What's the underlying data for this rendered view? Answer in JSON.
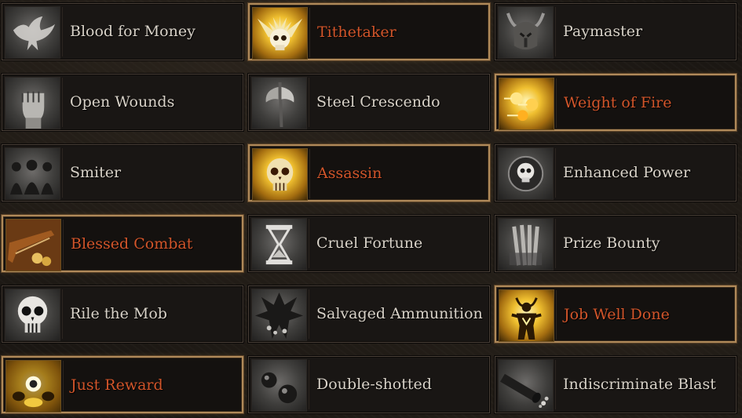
{
  "perks": [
    {
      "label": "Blood for Money",
      "icon": "dove-icon",
      "selected": false
    },
    {
      "label": "Tithetaker",
      "icon": "winged-skull-icon",
      "selected": true
    },
    {
      "label": "Paymaster",
      "icon": "horned-helmet-icon",
      "selected": false
    },
    {
      "label": "Open Wounds",
      "icon": "fist-icon",
      "selected": false
    },
    {
      "label": "Steel Crescendo",
      "icon": "axe-icon",
      "selected": false
    },
    {
      "label": "Weight of Fire",
      "icon": "fire-orbs-icon",
      "selected": true
    },
    {
      "label": "Smiter",
      "icon": "shadow-figures-icon",
      "selected": false
    },
    {
      "label": "Assassin",
      "icon": "glowing-skull-icon",
      "selected": true
    },
    {
      "label": "Enhanced Power",
      "icon": "skull-circle-icon",
      "selected": false
    },
    {
      "label": "Blessed Combat",
      "icon": "flintlock-icon",
      "selected": true
    },
    {
      "label": "Cruel Fortune",
      "icon": "hourglass-icon",
      "selected": false
    },
    {
      "label": "Prize Bounty",
      "icon": "scrolls-icon",
      "selected": false
    },
    {
      "label": "Rile the Mob",
      "icon": "skull-icon",
      "selected": false
    },
    {
      "label": "Salvaged Ammunition",
      "icon": "demon-icon",
      "selected": false
    },
    {
      "label": "Job Well Done",
      "icon": "horned-figure-icon",
      "selected": true
    },
    {
      "label": "Just Reward",
      "icon": "golden-treasure-icon",
      "selected": true
    },
    {
      "label": "Double-shotted",
      "icon": "cannonballs-icon",
      "selected": false
    },
    {
      "label": "Indiscriminate Blast",
      "icon": "cannon-barrel-icon",
      "selected": false
    }
  ],
  "colors": {
    "selected_text": "#d2552a",
    "normal_text": "#d8d2c8",
    "selected_border": "#b08a5a"
  }
}
